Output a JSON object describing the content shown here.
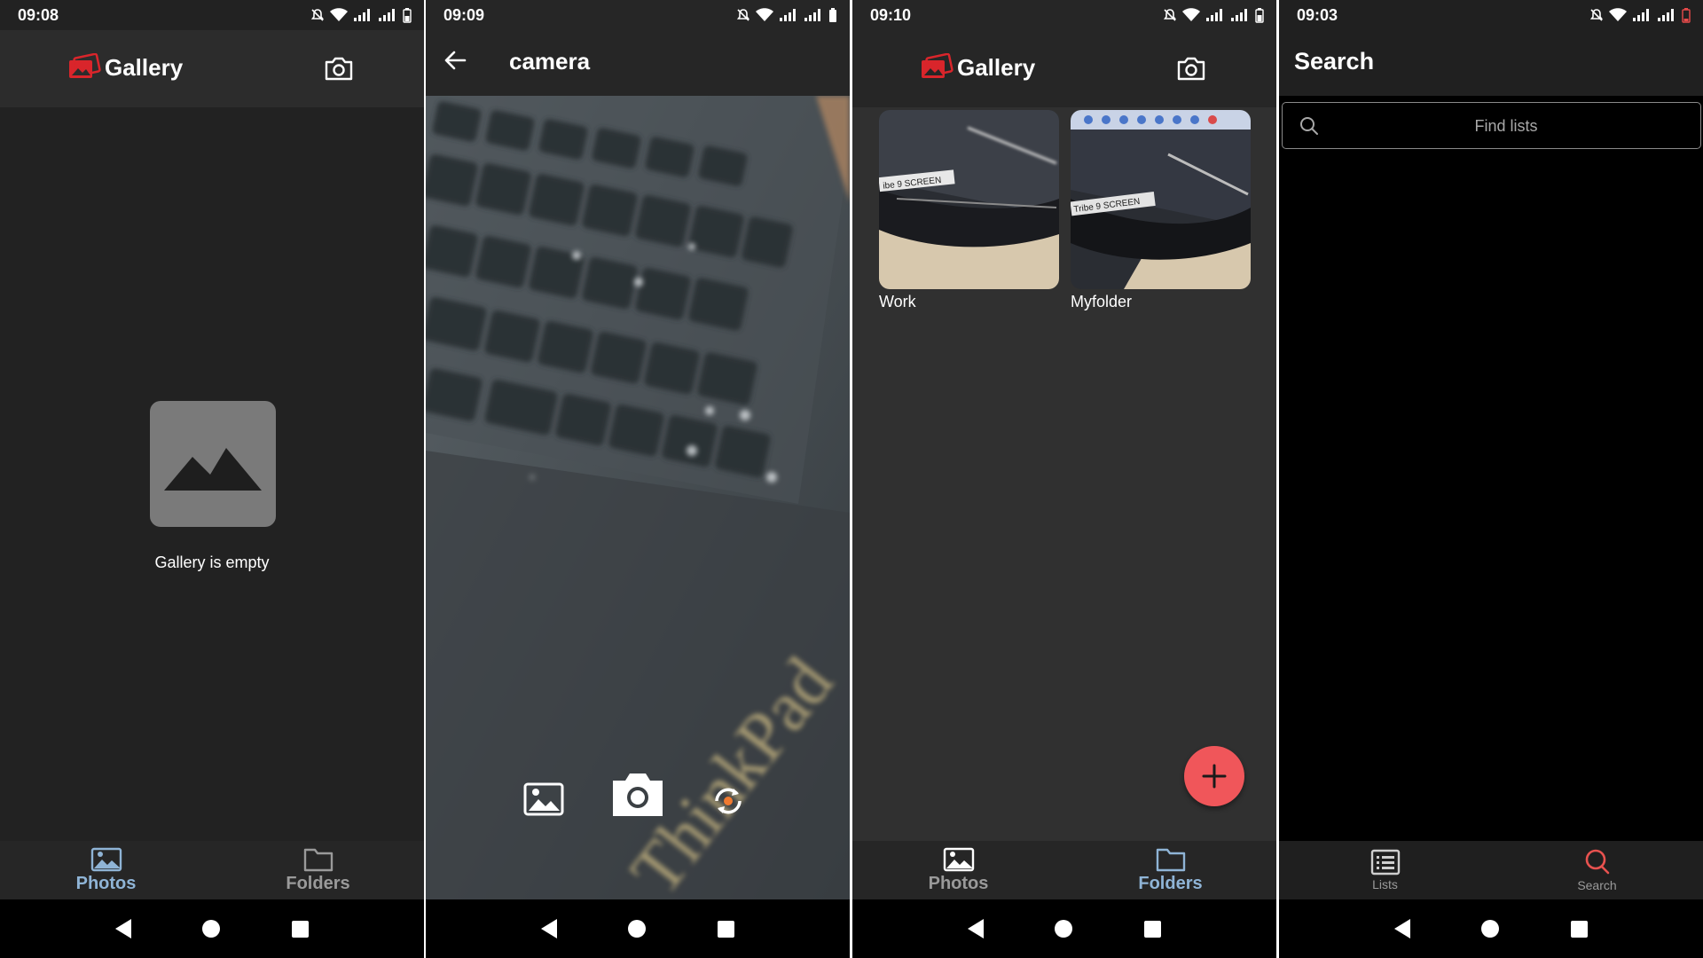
{
  "screens": {
    "gallery_empty": {
      "status_time": "09:08",
      "app_title": "Gallery",
      "empty_message": "Gallery is empty",
      "nav": {
        "photos": "Photos",
        "folders": "Folders"
      }
    },
    "camera": {
      "status_time": "09:09",
      "title": "camera"
    },
    "gallery_folders": {
      "status_time": "09:10",
      "app_title": "Gallery",
      "folders": [
        {
          "name": "Work",
          "thumb_label": "ibe 9 SCREEN"
        },
        {
          "name": "Myfolder",
          "thumb_label": "Tribe 9 SCREEN"
        }
      ],
      "nav": {
        "photos": "Photos",
        "folders": "Folders"
      }
    },
    "search": {
      "status_time": "09:03",
      "title": "Search",
      "search_placeholder": "Find lists",
      "nav": {
        "lists": "Lists",
        "search": "Search"
      }
    }
  },
  "colors": {
    "accent_red": "#f0565a",
    "nav_active_blue": "#8fb4d6",
    "nav_inactive": "#9a9a9a",
    "search_active_red": "#e8524f"
  }
}
